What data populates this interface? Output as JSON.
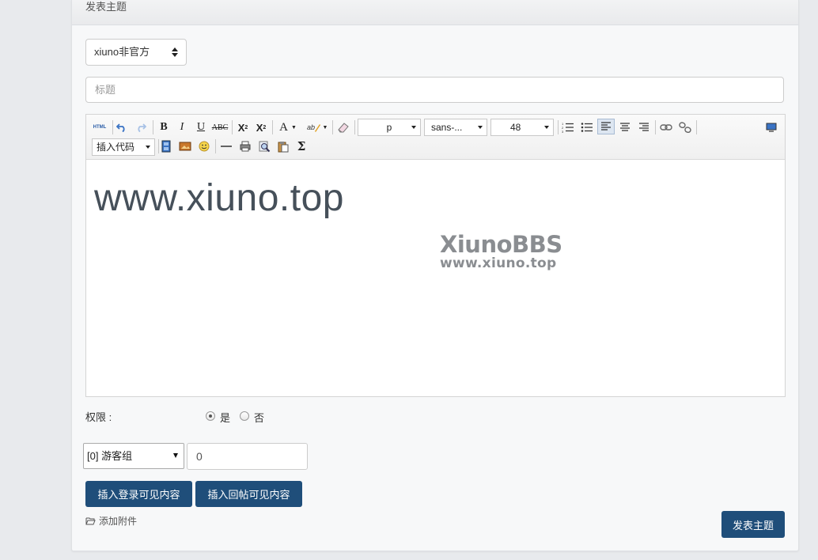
{
  "header": {
    "title": "发表主题"
  },
  "forum_select": {
    "value": "xiuno非官方"
  },
  "title_field": {
    "placeholder": "标题"
  },
  "toolbar": {
    "html_label": "HTML",
    "paragraph": "p",
    "font_family": "sans-...",
    "font_size": "48",
    "insert_code": "插入代码"
  },
  "editor": {
    "content": "www.xiuno.top",
    "watermark_title": "XiunoBBS",
    "watermark_url": "www.xiuno.top"
  },
  "permission": {
    "label": "权限 :",
    "yes": "是",
    "no": "否",
    "selected": "是"
  },
  "group_select": {
    "value": "[0] 游客组"
  },
  "amount_input": {
    "value": "0"
  },
  "buttons": {
    "insert_login": "插入登录可见内容",
    "insert_reply": "插入回帖可见内容",
    "submit": "发表主题"
  },
  "attachment": {
    "label": "添加附件"
  }
}
